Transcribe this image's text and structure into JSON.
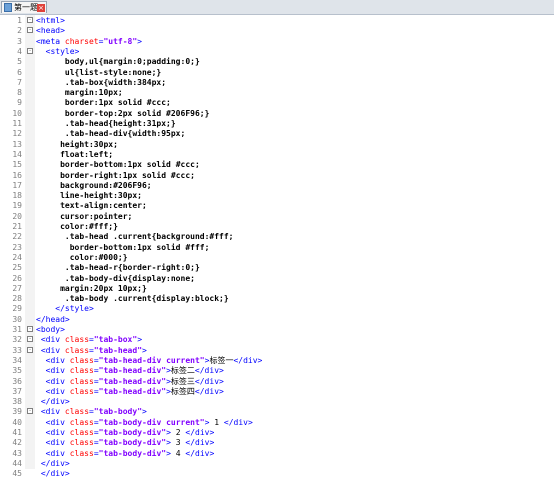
{
  "tab": {
    "title": "第一题"
  },
  "lines": [
    {
      "n": "1",
      "fold": "-",
      "indent": "",
      "parts": [
        [
          "tag",
          "<html>"
        ]
      ]
    },
    {
      "n": "2",
      "fold": "-",
      "indent": "",
      "parts": [
        [
          "tag",
          "<head>"
        ]
      ]
    },
    {
      "n": "3",
      "fold": "",
      "indent": "",
      "parts": [
        [
          "tag",
          "<meta "
        ],
        [
          "attr",
          "charset"
        ],
        [
          "tag",
          "="
        ],
        [
          "val",
          "\"utf-8\""
        ],
        [
          "tag",
          ">"
        ]
      ]
    },
    {
      "n": "4",
      "fold": "-",
      "indent": "  ",
      "parts": [
        [
          "tag",
          "<style>"
        ]
      ]
    },
    {
      "n": "5",
      "fold": "",
      "indent": "      ",
      "parts": [
        [
          "css",
          "body,ul{margin:0;padding:0;}"
        ]
      ]
    },
    {
      "n": "6",
      "fold": "",
      "indent": "      ",
      "parts": [
        [
          "css",
          "ul{list-style:none;}"
        ]
      ]
    },
    {
      "n": "7",
      "fold": "",
      "indent": "      ",
      "parts": [
        [
          "css",
          ".tab-box{width:384px;"
        ]
      ]
    },
    {
      "n": "8",
      "fold": "",
      "indent": "      ",
      "parts": [
        [
          "css",
          "margin:10px;"
        ]
      ]
    },
    {
      "n": "9",
      "fold": "",
      "indent": "      ",
      "parts": [
        [
          "css",
          "border:1px solid #ccc;"
        ]
      ]
    },
    {
      "n": "10",
      "fold": "",
      "indent": "      ",
      "parts": [
        [
          "css",
          "border-top:2px solid #206F96;}"
        ]
      ]
    },
    {
      "n": "11",
      "fold": "",
      "indent": "      ",
      "parts": [
        [
          "css",
          ".tab-head{height:31px;}"
        ]
      ]
    },
    {
      "n": "12",
      "fold": "",
      "indent": "      ",
      "parts": [
        [
          "css",
          ".tab-head-div{width:95px;"
        ]
      ]
    },
    {
      "n": "13",
      "fold": "",
      "indent": "     ",
      "parts": [
        [
          "css",
          "height:30px;"
        ]
      ]
    },
    {
      "n": "14",
      "fold": "",
      "indent": "     ",
      "parts": [
        [
          "css",
          "float:left;"
        ]
      ]
    },
    {
      "n": "15",
      "fold": "",
      "indent": "     ",
      "parts": [
        [
          "css",
          "border-bottom:1px solid #ccc;"
        ]
      ]
    },
    {
      "n": "16",
      "fold": "",
      "indent": "     ",
      "parts": [
        [
          "css",
          "border-right:1px solid #ccc;"
        ]
      ]
    },
    {
      "n": "17",
      "fold": "",
      "indent": "     ",
      "parts": [
        [
          "css",
          "background:#206F96;"
        ]
      ]
    },
    {
      "n": "18",
      "fold": "",
      "indent": "     ",
      "parts": [
        [
          "css",
          "line-height:30px;"
        ]
      ]
    },
    {
      "n": "19",
      "fold": "",
      "indent": "     ",
      "parts": [
        [
          "css",
          "text-align:center;"
        ]
      ]
    },
    {
      "n": "20",
      "fold": "",
      "indent": "     ",
      "parts": [
        [
          "css",
          "cursor:pointer;"
        ]
      ]
    },
    {
      "n": "21",
      "fold": "",
      "indent": "     ",
      "parts": [
        [
          "css",
          "color:#fff;}"
        ]
      ]
    },
    {
      "n": "22",
      "fold": "",
      "indent": "      ",
      "parts": [
        [
          "css",
          ".tab-head .current{background:#fff;"
        ]
      ]
    },
    {
      "n": "23",
      "fold": "",
      "indent": "       ",
      "parts": [
        [
          "css",
          "border-bottom:1px solid #fff;"
        ]
      ]
    },
    {
      "n": "24",
      "fold": "",
      "indent": "       ",
      "parts": [
        [
          "css",
          "color:#000;}"
        ]
      ]
    },
    {
      "n": "25",
      "fold": "",
      "indent": "      ",
      "parts": [
        [
          "css",
          ".tab-head-r{border-right:0;}"
        ]
      ]
    },
    {
      "n": "26",
      "fold": "",
      "indent": "      ",
      "parts": [
        [
          "css",
          ".tab-body-div{display:none;"
        ]
      ]
    },
    {
      "n": "27",
      "fold": "",
      "indent": "     ",
      "parts": [
        [
          "css",
          "margin:20px 10px;}"
        ]
      ]
    },
    {
      "n": "28",
      "fold": "",
      "indent": "      ",
      "parts": [
        [
          "css",
          ".tab-body .current{display:block;}"
        ]
      ]
    },
    {
      "n": "29",
      "fold": "",
      "indent": "    ",
      "parts": [
        [
          "tag",
          "</style>"
        ]
      ]
    },
    {
      "n": "30",
      "fold": "",
      "indent": "",
      "parts": [
        [
          "tag",
          "</head>"
        ]
      ]
    },
    {
      "n": "31",
      "fold": "-",
      "indent": "",
      "parts": [
        [
          "tag",
          "<body>"
        ]
      ]
    },
    {
      "n": "32",
      "fold": "-",
      "indent": " ",
      "parts": [
        [
          "tag",
          "<div "
        ],
        [
          "attr",
          "class"
        ],
        [
          "tag",
          "="
        ],
        [
          "val",
          "\"tab-box\""
        ],
        [
          "tag",
          ">"
        ]
      ]
    },
    {
      "n": "33",
      "fold": "-",
      "indent": " ",
      "parts": [
        [
          "tag",
          "<div "
        ],
        [
          "attr",
          "class"
        ],
        [
          "tag",
          "="
        ],
        [
          "val",
          "\"tab-head\""
        ],
        [
          "tag",
          ">"
        ]
      ]
    },
    {
      "n": "34",
      "fold": "",
      "indent": "  ",
      "parts": [
        [
          "tag",
          "<div "
        ],
        [
          "attr",
          "class"
        ],
        [
          "tag",
          "="
        ],
        [
          "val",
          "\"tab-head-div current\""
        ],
        [
          "tag",
          ">"
        ],
        [
          "txt",
          "标签一"
        ],
        [
          "tag",
          "</div>"
        ]
      ]
    },
    {
      "n": "35",
      "fold": "",
      "indent": "  ",
      "parts": [
        [
          "tag",
          "<div "
        ],
        [
          "attr",
          "class"
        ],
        [
          "tag",
          "="
        ],
        [
          "val",
          "\"tab-head-div\""
        ],
        [
          "tag",
          ">"
        ],
        [
          "txt",
          "标签二"
        ],
        [
          "tag",
          "</div>"
        ]
      ]
    },
    {
      "n": "36",
      "fold": "",
      "indent": "  ",
      "parts": [
        [
          "tag",
          "<div "
        ],
        [
          "attr",
          "class"
        ],
        [
          "tag",
          "="
        ],
        [
          "val",
          "\"tab-head-div\""
        ],
        [
          "tag",
          ">"
        ],
        [
          "txt",
          "标签三"
        ],
        [
          "tag",
          "</div>"
        ]
      ]
    },
    {
      "n": "37",
      "fold": "",
      "indent": "  ",
      "parts": [
        [
          "tag",
          "<div "
        ],
        [
          "attr",
          "class"
        ],
        [
          "tag",
          "="
        ],
        [
          "val",
          "\"tab-head-div\""
        ],
        [
          "tag",
          ">"
        ],
        [
          "txt",
          "标签四"
        ],
        [
          "tag",
          "</div>"
        ]
      ]
    },
    {
      "n": "38",
      "fold": "",
      "indent": " ",
      "parts": [
        [
          "tag",
          "</div>"
        ]
      ]
    },
    {
      "n": "39",
      "fold": "-",
      "indent": " ",
      "parts": [
        [
          "tag",
          "<div "
        ],
        [
          "attr",
          "class"
        ],
        [
          "tag",
          "="
        ],
        [
          "val",
          "\"tab-body\""
        ],
        [
          "tag",
          ">"
        ]
      ]
    },
    {
      "n": "40",
      "fold": "",
      "indent": "  ",
      "parts": [
        [
          "tag",
          "<div "
        ],
        [
          "attr",
          "class"
        ],
        [
          "tag",
          "="
        ],
        [
          "val",
          "\"tab-body-div current\""
        ],
        [
          "tag",
          ">"
        ],
        [
          "txt",
          " 1 "
        ],
        [
          "tag",
          "</div>"
        ]
      ]
    },
    {
      "n": "41",
      "fold": "",
      "indent": "  ",
      "parts": [
        [
          "tag",
          "<div "
        ],
        [
          "attr",
          "class"
        ],
        [
          "tag",
          "="
        ],
        [
          "val",
          "\"tab-body-div\""
        ],
        [
          "tag",
          ">"
        ],
        [
          "txt",
          " 2 "
        ],
        [
          "tag",
          "</div>"
        ]
      ]
    },
    {
      "n": "42",
      "fold": "",
      "indent": "  ",
      "parts": [
        [
          "tag",
          "<div "
        ],
        [
          "attr",
          "class"
        ],
        [
          "tag",
          "="
        ],
        [
          "val",
          "\"tab-body-div\""
        ],
        [
          "tag",
          ">"
        ],
        [
          "txt",
          " 3 "
        ],
        [
          "tag",
          "</div>"
        ]
      ]
    },
    {
      "n": "43",
      "fold": "",
      "indent": "  ",
      "parts": [
        [
          "tag",
          "<div "
        ],
        [
          "attr",
          "class"
        ],
        [
          "tag",
          "="
        ],
        [
          "val",
          "\"tab-body-div\""
        ],
        [
          "tag",
          ">"
        ],
        [
          "txt",
          " 4 "
        ],
        [
          "tag",
          "</div>"
        ]
      ]
    },
    {
      "n": "44",
      "fold": "",
      "indent": " ",
      "parts": [
        [
          "tag",
          "</div>"
        ]
      ]
    },
    {
      "n": "45",
      "fold": "",
      "indent": " ",
      "parts": [
        [
          "tag",
          "</div>"
        ]
      ]
    }
  ]
}
